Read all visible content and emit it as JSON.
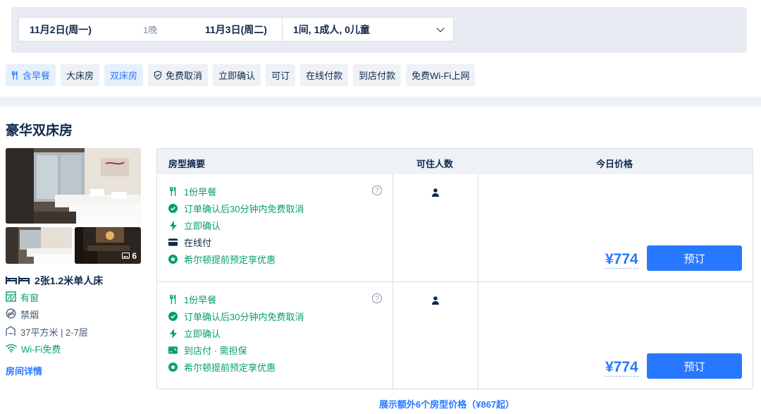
{
  "search": {
    "check_in": "11月2日(周一)",
    "nights": "1晚",
    "check_out": "11月3日(周二)",
    "guests": "1间, 1成人, 0儿童"
  },
  "filters": [
    {
      "label": "含早餐",
      "icon": "cutlery-icon",
      "active": true
    },
    {
      "label": "大床房",
      "active": false
    },
    {
      "label": "双床房",
      "active": true
    },
    {
      "label": "免费取消",
      "icon": "shield-check-icon",
      "active": false
    },
    {
      "label": "立即确认",
      "active": false
    },
    {
      "label": "可订",
      "active": false
    },
    {
      "label": "在线付款",
      "active": false
    },
    {
      "label": "到店付款",
      "active": false
    },
    {
      "label": "免费Wi-Fi上网",
      "active": false
    }
  ],
  "room": {
    "title": "豪华双床房",
    "photo_count": "6",
    "bed": "2张1.2米单人床",
    "window": "有窗",
    "smoking": "禁烟",
    "area": "37平方米 | 2-7层",
    "wifi": "Wi-Fi免费",
    "detail_link": "房间详情"
  },
  "table": {
    "col_summary": "房型摘要",
    "col_occupancy": "可住人数",
    "col_price": "今日价格"
  },
  "offers": [
    {
      "breakfast": "1份早餐",
      "cancel": "订单确认后30分钟内免费取消",
      "confirm": "立即确认",
      "payment": "在线付",
      "promo": "希尔顿提前预定享优惠",
      "price": "¥774",
      "book": "预订"
    },
    {
      "breakfast": "1份早餐",
      "cancel": "订单确认后30分钟内免费取消",
      "confirm": "立即确认",
      "payment": "到店付 · 需担保",
      "promo": "希尔顿提前预定享优惠",
      "price": "¥774",
      "book": "预订"
    }
  ],
  "more_rates": "展示额外6个房型价格（¥867起）",
  "colors": {
    "accent": "#2878ff",
    "green": "#06a06a",
    "text": "#0f294d"
  }
}
